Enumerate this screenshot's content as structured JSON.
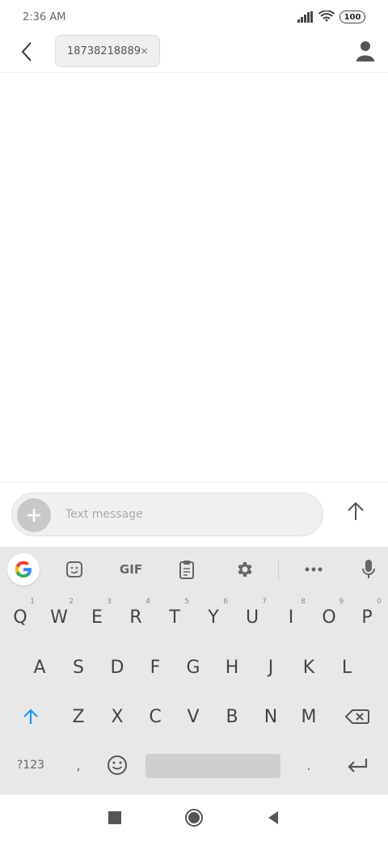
{
  "status": {
    "time": "2:36 AM",
    "battery": "100"
  },
  "header": {
    "recipient": "18738218889"
  },
  "compose": {
    "placeholder": "Text message"
  },
  "keyboard": {
    "toolbar": {
      "gif": "GIF"
    },
    "rows": {
      "row1": [
        {
          "k": "Q",
          "h": "1"
        },
        {
          "k": "W",
          "h": "2"
        },
        {
          "k": "E",
          "h": "3"
        },
        {
          "k": "R",
          "h": "4"
        },
        {
          "k": "T",
          "h": "5"
        },
        {
          "k": "Y",
          "h": "6"
        },
        {
          "k": "U",
          "h": "7"
        },
        {
          "k": "I",
          "h": "8"
        },
        {
          "k": "O",
          "h": "9"
        },
        {
          "k": "P",
          "h": "0"
        }
      ],
      "row2": [
        "A",
        "S",
        "D",
        "F",
        "G",
        "H",
        "J",
        "K",
        "L"
      ],
      "row3": [
        "Z",
        "X",
        "C",
        "V",
        "B",
        "N",
        "M"
      ],
      "bottom": {
        "numbers": "?123",
        "comma": ",",
        "period": "."
      }
    }
  },
  "colors": {
    "accent": "#2196F3",
    "keyboard_bg": "#E8E8E8"
  }
}
